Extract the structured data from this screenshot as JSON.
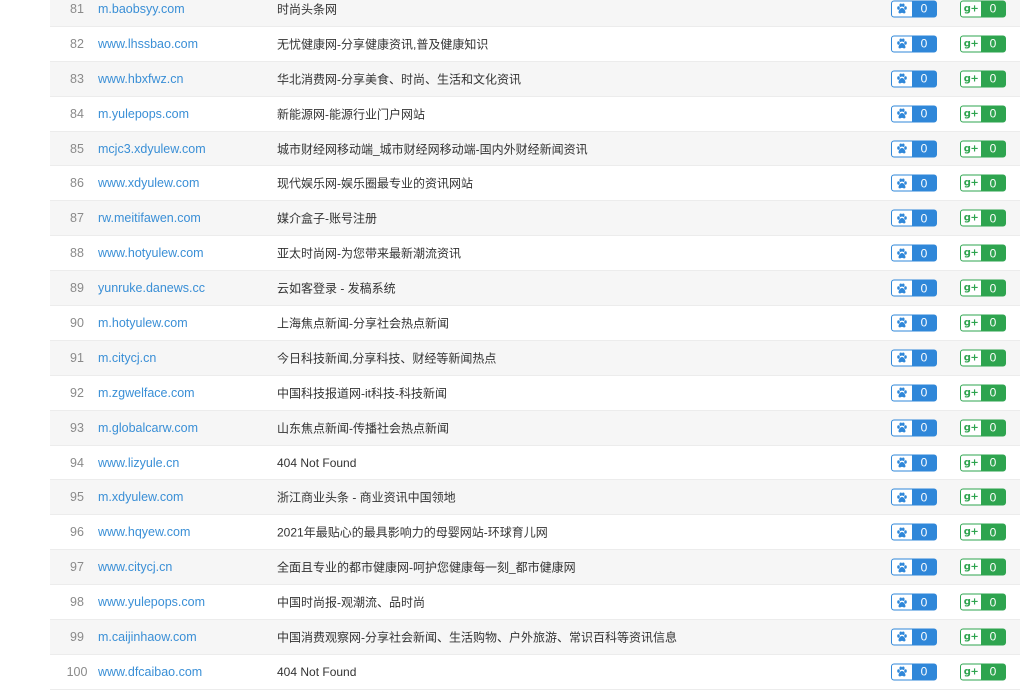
{
  "rows": [
    {
      "num": "81",
      "domain": "m.baobsyy.com",
      "desc": "时尚头条网",
      "baidu": "0",
      "google": "0"
    },
    {
      "num": "82",
      "domain": "www.lhssbao.com",
      "desc": "无忧健康网-分享健康资讯,普及健康知识",
      "baidu": "0",
      "google": "0"
    },
    {
      "num": "83",
      "domain": "www.hbxfwz.cn",
      "desc": "华北消费网-分享美食、时尚、生活和文化资讯",
      "baidu": "0",
      "google": "0"
    },
    {
      "num": "84",
      "domain": "m.yulepops.com",
      "desc": "新能源网-能源行业门户网站",
      "baidu": "0",
      "google": "0"
    },
    {
      "num": "85",
      "domain": "mcjc3.xdyulew.com",
      "desc": "城市财经网移动端_城市财经网移动端-国内外财经新闻资讯",
      "baidu": "0",
      "google": "0"
    },
    {
      "num": "86",
      "domain": "www.xdyulew.com",
      "desc": "现代娱乐网-娱乐圈最专业的资讯网站",
      "baidu": "0",
      "google": "0"
    },
    {
      "num": "87",
      "domain": "rw.meitifawen.com",
      "desc": "媒介盒子-账号注册",
      "baidu": "0",
      "google": "0"
    },
    {
      "num": "88",
      "domain": "www.hotyulew.com",
      "desc": "亚太时尚网-为您带来最新潮流资讯",
      "baidu": "0",
      "google": "0"
    },
    {
      "num": "89",
      "domain": "yunruke.danews.cc",
      "desc": "云如客登录 - 发稿系统",
      "baidu": "0",
      "google": "0"
    },
    {
      "num": "90",
      "domain": "m.hotyulew.com",
      "desc": "上海焦点新闻-分享社会热点新闻",
      "baidu": "0",
      "google": "0"
    },
    {
      "num": "91",
      "domain": "m.citycj.cn",
      "desc": "今日科技新闻,分享科技、财经等新闻热点",
      "baidu": "0",
      "google": "0"
    },
    {
      "num": "92",
      "domain": "m.zgwelface.com",
      "desc": "中国科技报道网-it科技-科技新闻",
      "baidu": "0",
      "google": "0"
    },
    {
      "num": "93",
      "domain": "m.globalcarw.com",
      "desc": "山东焦点新闻-传播社会热点新闻",
      "baidu": "0",
      "google": "0"
    },
    {
      "num": "94",
      "domain": "www.lizyule.cn",
      "desc": "404 Not Found",
      "baidu": "0",
      "google": "0"
    },
    {
      "num": "95",
      "domain": "m.xdyulew.com",
      "desc": "浙江商业头条 - 商业资讯中国领地",
      "baidu": "0",
      "google": "0"
    },
    {
      "num": "96",
      "domain": "www.hqyew.com",
      "desc": "2021年最贴心的最具影响力的母婴网站-环球育儿网",
      "baidu": "0",
      "google": "0"
    },
    {
      "num": "97",
      "domain": "www.citycj.cn",
      "desc": "全面且专业的都市健康网-呵护您健康每一刻_都市健康网",
      "baidu": "0",
      "google": "0"
    },
    {
      "num": "98",
      "domain": "www.yulepops.com",
      "desc": "中国时尚报-观潮流、品时尚",
      "baidu": "0",
      "google": "0"
    },
    {
      "num": "99",
      "domain": "m.caijinhaow.com",
      "desc": "中国消费观察网-分享社会新闻、生活购物、户外旅游、常识百科等资讯信息",
      "baidu": "0",
      "google": "0"
    },
    {
      "num": "100",
      "domain": "www.dfcaibao.com",
      "desc": "404 Not Found",
      "baidu": "0",
      "google": "0"
    }
  ],
  "icons": {
    "baidu": "paw-icon",
    "google": "google-plus-icon"
  },
  "colors": {
    "link": "#3a8fd6",
    "baidu": "#2f87d9",
    "google": "#2ea44f",
    "row_alt": "#f6f6f6"
  }
}
